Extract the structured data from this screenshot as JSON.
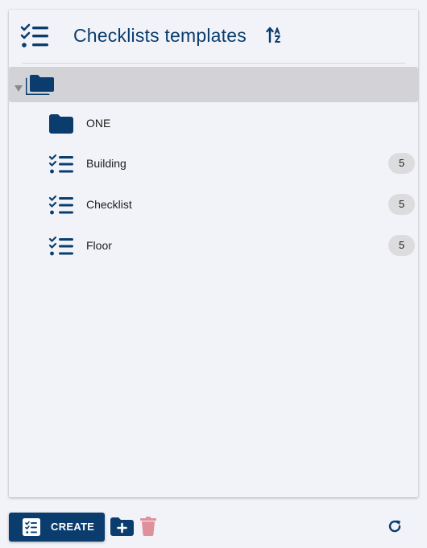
{
  "colors": {
    "primary": "#0a3d6e",
    "background": "#f2f3f8",
    "selected_row": "#d3d3d7",
    "badge_bg": "#dcdcde",
    "delete_disabled": "#e0909a"
  },
  "header": {
    "title": "Checklists templates",
    "icon": "checklist-icon",
    "sort_icon": "sort-alpha-icon"
  },
  "tree": {
    "root": {
      "icon": "folders-icon",
      "expanded": true
    },
    "items": [
      {
        "label": "ONE",
        "icon": "folder-icon",
        "badge": null
      },
      {
        "label": "Building",
        "icon": "checklist-icon",
        "badge": "5"
      },
      {
        "label": "Checklist",
        "icon": "checklist-icon",
        "badge": "5"
      },
      {
        "label": "Floor",
        "icon": "checklist-icon",
        "badge": "5"
      }
    ]
  },
  "footer": {
    "create_label": "CREATE",
    "create_icon": "checklist-box-icon",
    "add_folder_icon": "folder-plus-icon",
    "delete_icon": "trash-icon",
    "refresh_icon": "refresh-icon"
  }
}
